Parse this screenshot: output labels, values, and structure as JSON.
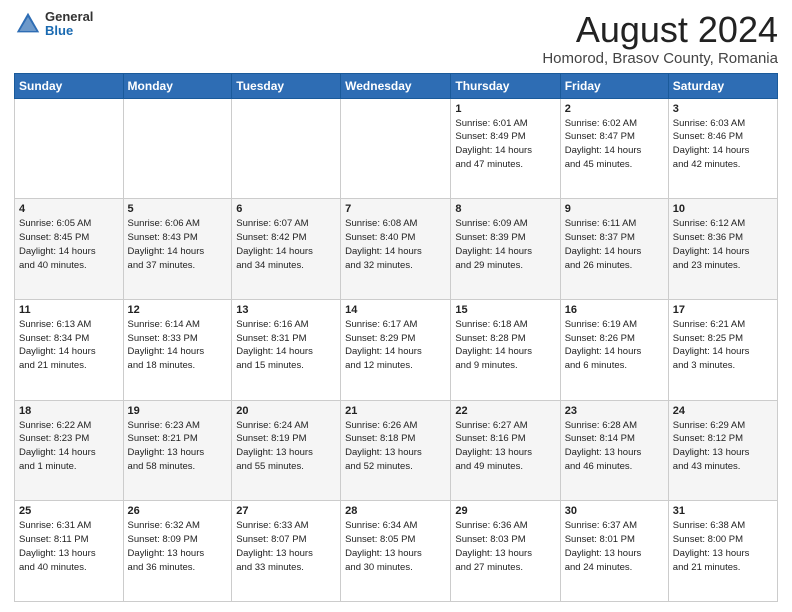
{
  "header": {
    "logo_general": "General",
    "logo_blue": "Blue",
    "title": "August 2024",
    "subtitle": "Homorod, Brasov County, Romania"
  },
  "days_of_week": [
    "Sunday",
    "Monday",
    "Tuesday",
    "Wednesday",
    "Thursday",
    "Friday",
    "Saturday"
  ],
  "weeks": [
    [
      {
        "day": "",
        "info": ""
      },
      {
        "day": "",
        "info": ""
      },
      {
        "day": "",
        "info": ""
      },
      {
        "day": "",
        "info": ""
      },
      {
        "day": "1",
        "info": "Sunrise: 6:01 AM\nSunset: 8:49 PM\nDaylight: 14 hours\nand 47 minutes."
      },
      {
        "day": "2",
        "info": "Sunrise: 6:02 AM\nSunset: 8:47 PM\nDaylight: 14 hours\nand 45 minutes."
      },
      {
        "day": "3",
        "info": "Sunrise: 6:03 AM\nSunset: 8:46 PM\nDaylight: 14 hours\nand 42 minutes."
      }
    ],
    [
      {
        "day": "4",
        "info": "Sunrise: 6:05 AM\nSunset: 8:45 PM\nDaylight: 14 hours\nand 40 minutes."
      },
      {
        "day": "5",
        "info": "Sunrise: 6:06 AM\nSunset: 8:43 PM\nDaylight: 14 hours\nand 37 minutes."
      },
      {
        "day": "6",
        "info": "Sunrise: 6:07 AM\nSunset: 8:42 PM\nDaylight: 14 hours\nand 34 minutes."
      },
      {
        "day": "7",
        "info": "Sunrise: 6:08 AM\nSunset: 8:40 PM\nDaylight: 14 hours\nand 32 minutes."
      },
      {
        "day": "8",
        "info": "Sunrise: 6:09 AM\nSunset: 8:39 PM\nDaylight: 14 hours\nand 29 minutes."
      },
      {
        "day": "9",
        "info": "Sunrise: 6:11 AM\nSunset: 8:37 PM\nDaylight: 14 hours\nand 26 minutes."
      },
      {
        "day": "10",
        "info": "Sunrise: 6:12 AM\nSunset: 8:36 PM\nDaylight: 14 hours\nand 23 minutes."
      }
    ],
    [
      {
        "day": "11",
        "info": "Sunrise: 6:13 AM\nSunset: 8:34 PM\nDaylight: 14 hours\nand 21 minutes."
      },
      {
        "day": "12",
        "info": "Sunrise: 6:14 AM\nSunset: 8:33 PM\nDaylight: 14 hours\nand 18 minutes."
      },
      {
        "day": "13",
        "info": "Sunrise: 6:16 AM\nSunset: 8:31 PM\nDaylight: 14 hours\nand 15 minutes."
      },
      {
        "day": "14",
        "info": "Sunrise: 6:17 AM\nSunset: 8:29 PM\nDaylight: 14 hours\nand 12 minutes."
      },
      {
        "day": "15",
        "info": "Sunrise: 6:18 AM\nSunset: 8:28 PM\nDaylight: 14 hours\nand 9 minutes."
      },
      {
        "day": "16",
        "info": "Sunrise: 6:19 AM\nSunset: 8:26 PM\nDaylight: 14 hours\nand 6 minutes."
      },
      {
        "day": "17",
        "info": "Sunrise: 6:21 AM\nSunset: 8:25 PM\nDaylight: 14 hours\nand 3 minutes."
      }
    ],
    [
      {
        "day": "18",
        "info": "Sunrise: 6:22 AM\nSunset: 8:23 PM\nDaylight: 14 hours\nand 1 minute."
      },
      {
        "day": "19",
        "info": "Sunrise: 6:23 AM\nSunset: 8:21 PM\nDaylight: 13 hours\nand 58 minutes."
      },
      {
        "day": "20",
        "info": "Sunrise: 6:24 AM\nSunset: 8:19 PM\nDaylight: 13 hours\nand 55 minutes."
      },
      {
        "day": "21",
        "info": "Sunrise: 6:26 AM\nSunset: 8:18 PM\nDaylight: 13 hours\nand 52 minutes."
      },
      {
        "day": "22",
        "info": "Sunrise: 6:27 AM\nSunset: 8:16 PM\nDaylight: 13 hours\nand 49 minutes."
      },
      {
        "day": "23",
        "info": "Sunrise: 6:28 AM\nSunset: 8:14 PM\nDaylight: 13 hours\nand 46 minutes."
      },
      {
        "day": "24",
        "info": "Sunrise: 6:29 AM\nSunset: 8:12 PM\nDaylight: 13 hours\nand 43 minutes."
      }
    ],
    [
      {
        "day": "25",
        "info": "Sunrise: 6:31 AM\nSunset: 8:11 PM\nDaylight: 13 hours\nand 40 minutes."
      },
      {
        "day": "26",
        "info": "Sunrise: 6:32 AM\nSunset: 8:09 PM\nDaylight: 13 hours\nand 36 minutes."
      },
      {
        "day": "27",
        "info": "Sunrise: 6:33 AM\nSunset: 8:07 PM\nDaylight: 13 hours\nand 33 minutes."
      },
      {
        "day": "28",
        "info": "Sunrise: 6:34 AM\nSunset: 8:05 PM\nDaylight: 13 hours\nand 30 minutes."
      },
      {
        "day": "29",
        "info": "Sunrise: 6:36 AM\nSunset: 8:03 PM\nDaylight: 13 hours\nand 27 minutes."
      },
      {
        "day": "30",
        "info": "Sunrise: 6:37 AM\nSunset: 8:01 PM\nDaylight: 13 hours\nand 24 minutes."
      },
      {
        "day": "31",
        "info": "Sunrise: 6:38 AM\nSunset: 8:00 PM\nDaylight: 13 hours\nand 21 minutes."
      }
    ]
  ]
}
